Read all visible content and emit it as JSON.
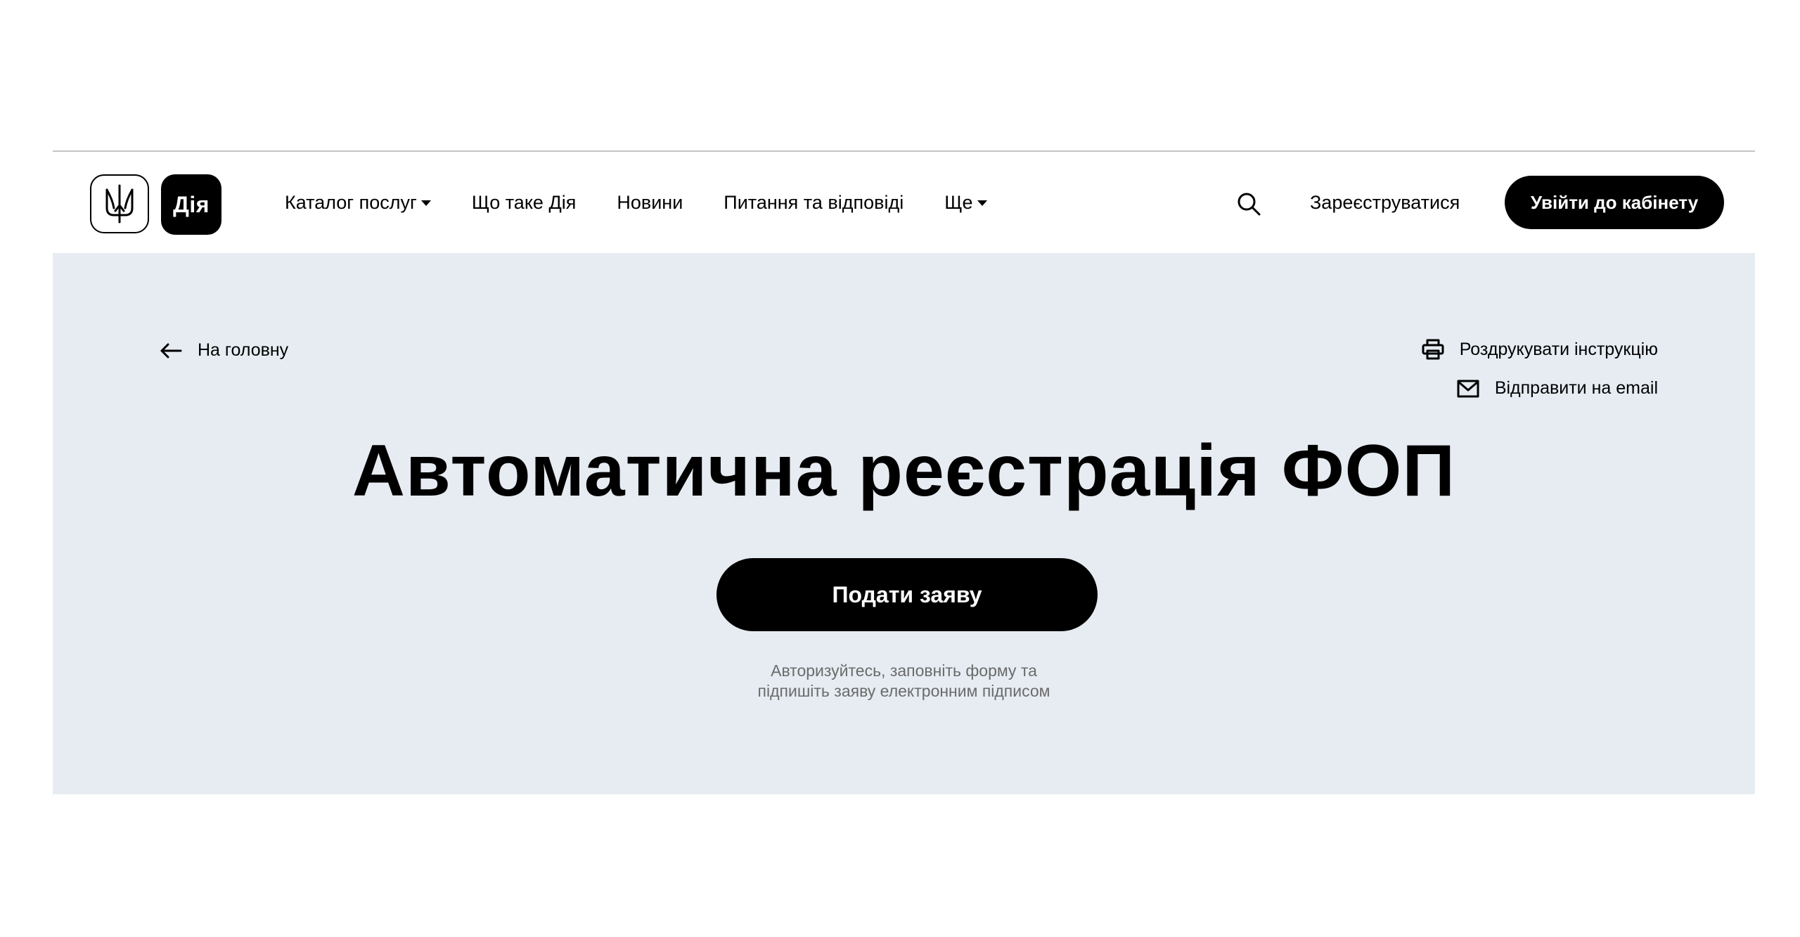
{
  "header": {
    "logo_text": "Дія",
    "nav": [
      {
        "label": "Каталог послуг",
        "has_dropdown": true
      },
      {
        "label": "Що таке Дія",
        "has_dropdown": false
      },
      {
        "label": "Новини",
        "has_dropdown": false
      },
      {
        "label": "Питання та відповіді",
        "has_dropdown": false
      },
      {
        "label": "Ще",
        "has_dropdown": true
      }
    ],
    "search_icon": "search-icon",
    "register_label": "Зареєструватися",
    "login_label": "Увійти до кабінету"
  },
  "hero": {
    "back_label": "На головну",
    "print_label": "Роздрукувати інструкцію",
    "email_label": "Відправити на email",
    "title": "Автоматична реєстрація ФОП",
    "apply_label": "Подати заяву",
    "hint_line1": "Авторизуйтесь, заповніть форму та",
    "hint_line2": "підпишіть заяву електронним підписом"
  },
  "colors": {
    "hero_background": "#e6ecf2",
    "primary": "#000000",
    "hint_text": "#6b6b6b",
    "divider": "#c4c4c4"
  }
}
